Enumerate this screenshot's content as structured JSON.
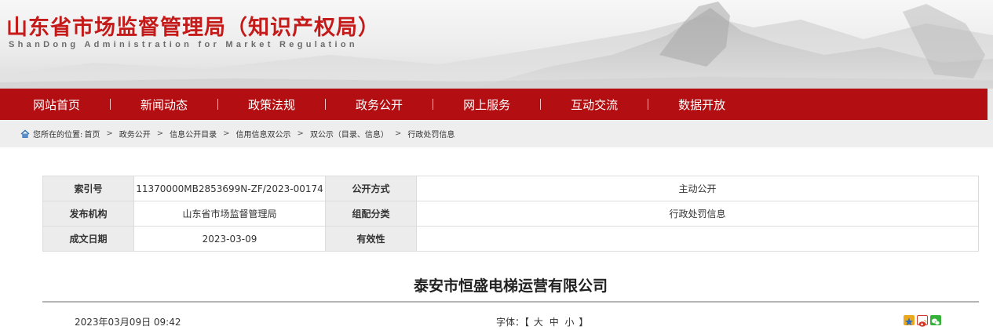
{
  "header": {
    "title": "山东省市场监督管理局（知识产权局）",
    "subtitle": "ShanDong Administration for Market Regulation"
  },
  "nav": {
    "items": [
      "网站首页",
      "新闻动态",
      "政策法规",
      "政务公开",
      "网上服务",
      "互动交流",
      "数据开放"
    ]
  },
  "breadcrumb": {
    "prefix": "您所在的位置:",
    "items": [
      "首页",
      "政务公开",
      "信息公开目录",
      "信用信息双公示",
      "双公示（目录、信息）",
      "行政处罚信息"
    ],
    "separator": ">"
  },
  "info": {
    "index_label": "索引号",
    "index_value": "11370000MB2853699N-ZF/2023-00174",
    "disclosure_label": "公开方式",
    "disclosure_value": "主动公开",
    "publisher_label": "发布机构",
    "publisher_value": "山东省市场监督管理局",
    "category_label": "组配分类",
    "category_value": "行政处罚信息",
    "date_label": "成文日期",
    "date_value": "2023-03-09",
    "validity_label": "有效性",
    "validity_value": ""
  },
  "article": {
    "title": "泰安市恒盛电梯运营有限公司",
    "datetime": "2023年03月09日 09:42",
    "font_label": "字体：【",
    "font_large": "大",
    "font_medium": "中",
    "font_small": "小",
    "font_close": "】"
  },
  "colors": {
    "brand_red": "#b30f12",
    "title_red": "#c41a1a"
  },
  "icons": [
    "home-icon",
    "share-star-icon",
    "share-weibo-icon",
    "share-wechat-icon"
  ]
}
